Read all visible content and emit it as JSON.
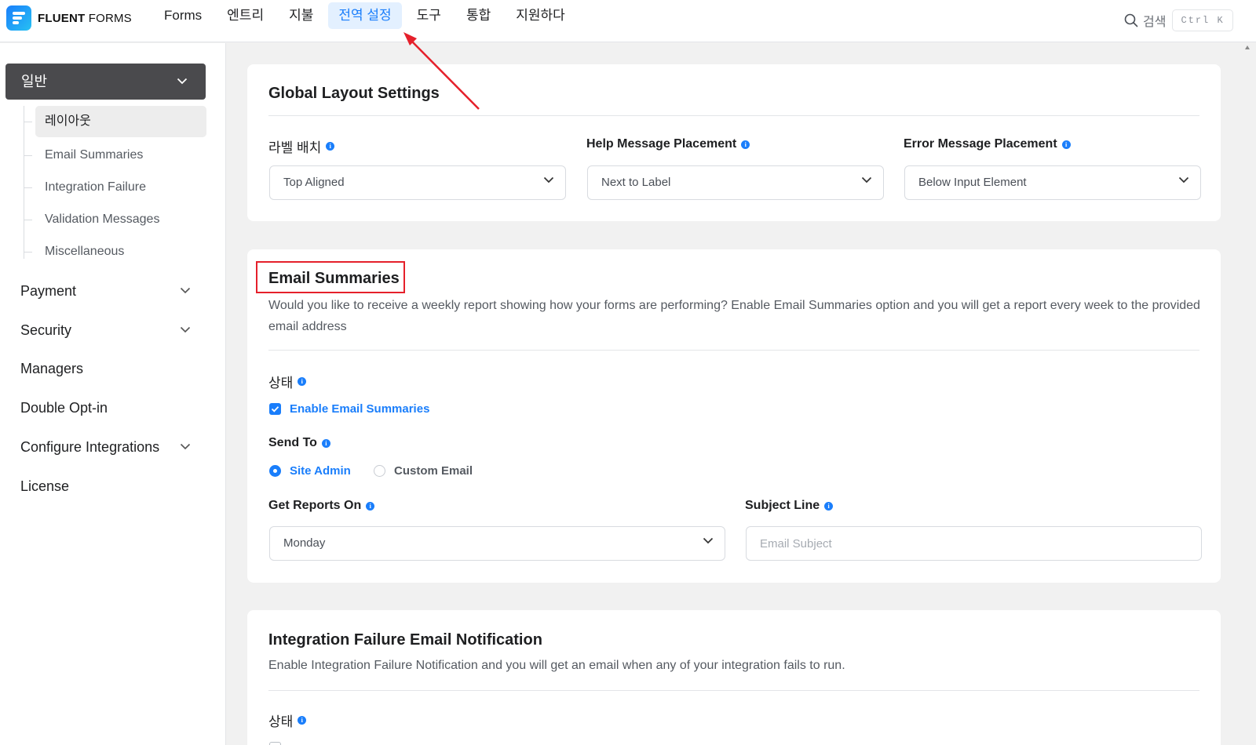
{
  "brand": {
    "name_bold": "FLUENT",
    "name_light": " FORMS"
  },
  "nav": {
    "items": [
      "Forms",
      "엔트리",
      "지불",
      "전역 설정",
      "도구",
      "통합",
      "지원하다"
    ],
    "active_index": 3
  },
  "search": {
    "label": "검색",
    "shortcut": "Ctrl K"
  },
  "sidebar": {
    "group": "일반",
    "sub_items": [
      "레이아웃",
      "Email Summaries",
      "Integration Failure",
      "Validation Messages",
      "Miscellaneous"
    ],
    "active_sub": "레이아웃",
    "items": [
      "Payment",
      "Security",
      "Managers",
      "Double Opt-in",
      "Configure Integrations",
      "License"
    ]
  },
  "layout_card": {
    "title": "Global Layout Settings",
    "label_placement": {
      "label": "라벨 배치",
      "value": "Top Aligned"
    },
    "help_placement": {
      "label": "Help Message Placement",
      "value": "Next to Label"
    },
    "error_placement": {
      "label": "Error Message Placement",
      "value": "Below Input Element"
    }
  },
  "email_card": {
    "title": "Email Summaries",
    "description": "Would you like to receive a weekly report showing how your forms are performing? Enable Email Summaries option and you will get a report every week to the provided email address",
    "status_label": "상태",
    "enable_label": "Enable Email Summaries",
    "enabled": true,
    "send_to_label": "Send To",
    "send_to_options": [
      "Site Admin",
      "Custom Email"
    ],
    "send_to_selected": "Site Admin",
    "reports_on_label": "Get Reports On",
    "reports_on_value": "Monday",
    "subject_label": "Subject Line",
    "subject_placeholder": "Email Subject",
    "subject_value": ""
  },
  "failure_card": {
    "title": "Integration Failure Email Notification",
    "description": "Enable Integration Failure Notification and you will get an email when any of your integration fails to run.",
    "status_label": "상태"
  },
  "colors": {
    "accent": "#1a7efb",
    "annotation": "#e5202b",
    "sidebar_group_bg": "#4a4a4d"
  }
}
